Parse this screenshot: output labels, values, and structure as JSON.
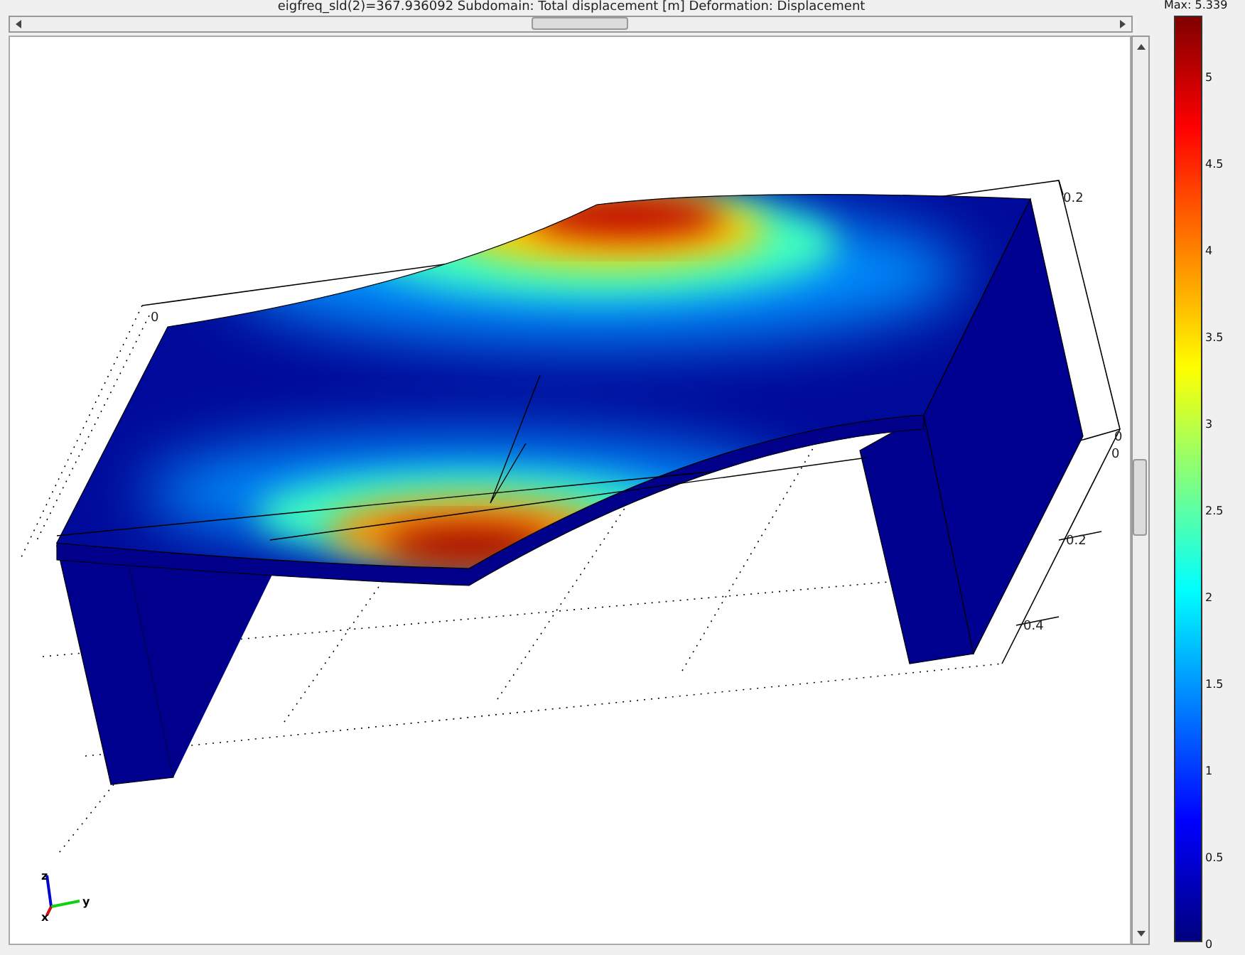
{
  "plot_title": "eigfreq_sld(2)=367.936092    Subdomain: Total displacement [m]    Deformation: Displacement",
  "axis_labels": [
    "0",
    "0.2",
    "0",
    "0",
    "0.2",
    "0.4"
  ],
  "triad": {
    "z": "z",
    "y": "y",
    "x": "x"
  },
  "colorbar": {
    "max_label": "Max: 5.339",
    "ticks": [
      "5",
      "4.5",
      "4",
      "3.5",
      "3",
      "2.5",
      "2",
      "1.5",
      "1",
      "0.5",
      "0"
    ]
  }
}
